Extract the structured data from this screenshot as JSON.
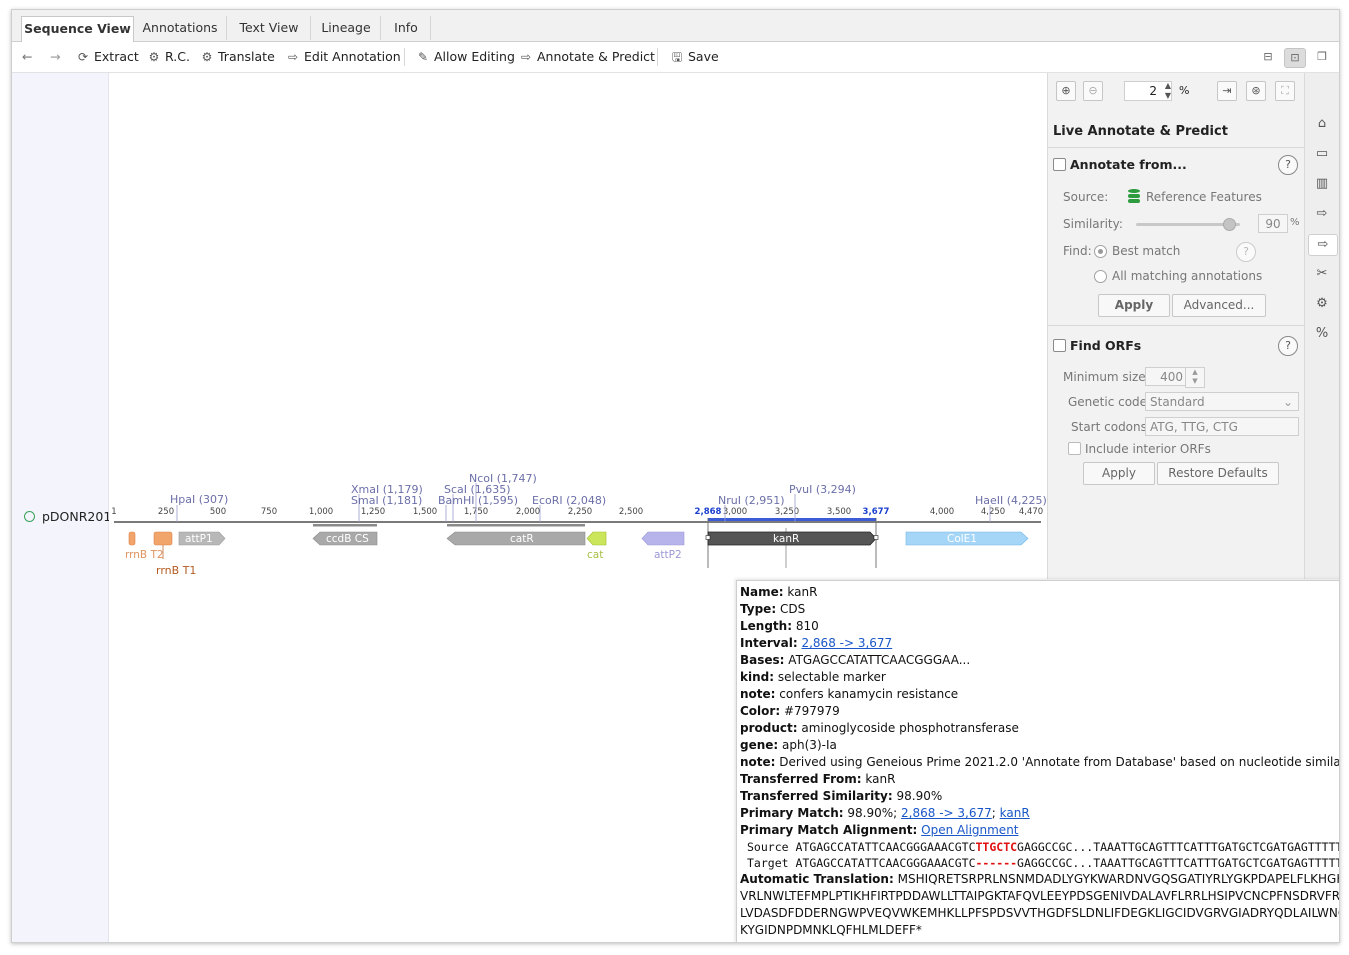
{
  "tabs": [
    "Sequence View",
    "Annotations",
    "Text View",
    "Lineage",
    "Info"
  ],
  "toolbar": {
    "extract": "Extract",
    "rc": "R.C.",
    "translate": "Translate",
    "edit_annotation": "Edit Annotation",
    "allow_editing": "Allow Editing",
    "annotate_predict": "Annotate & Predict",
    "save": "Save"
  },
  "sequence": {
    "name": "pDONR201"
  },
  "map": {
    "ruler_ticks": [
      "1",
      "250",
      "500",
      "750",
      "1,000",
      "1,250",
      "1,500",
      "1,750",
      "2,000",
      "2,250",
      "2,500",
      "3,000",
      "3,250",
      "3,500",
      "4,000",
      "4,250",
      "4,470"
    ],
    "selection_start": "2,868",
    "selection_end": "3,677",
    "enzymes": [
      "HpaI (307)",
      "XmaI (1,179)",
      "SmaI (1,181)",
      "NcoI (1,747)",
      "ScaI (1,635)",
      "BamHI (1,595)",
      "EcoRI (2,048)",
      "NruI (2,951)",
      "PvuI (3,294)",
      "HaeII (4,225)"
    ],
    "features": {
      "rrnB_T2": "rrnB T2",
      "rrnB_T1": "rrnB T1",
      "attP1": "attP1",
      "ccdB": "ccdB CS",
      "catR": "catR",
      "cat": "cat",
      "attP2": "attP2",
      "kanR": "kanR",
      "ColE1": "ColE1"
    }
  },
  "zoom": {
    "value": "2",
    "unit": "%"
  },
  "panel": {
    "title": "Live Annotate & Predict",
    "annotate_from": "Annotate from...",
    "source_label": "Source:",
    "source_value": "Reference Features",
    "similarity_label": "Similarity:",
    "similarity_value": "90",
    "similarity_unit": "%",
    "find_label": "Find:",
    "best_match": "Best match",
    "all_matching": "All matching annotations",
    "apply": "Apply",
    "advanced": "Advanced...",
    "find_orfs": "Find ORFs",
    "min_size_label": "Minimum size:",
    "min_size_value": "400",
    "genetic_code_label": "Genetic code:",
    "genetic_code_value": "Standard",
    "start_codons_label": "Start codons:",
    "start_codons_value": "ATG, TTG, CTG",
    "include_interior": "Include interior ORFs",
    "apply2": "Apply",
    "restore": "Restore Defaults"
  },
  "tooltip": {
    "name_k": "Name:",
    "name_v": "kanR",
    "type_k": "Type:",
    "type_v": "CDS",
    "length_k": "Length:",
    "length_v": "810",
    "interval_k": "Interval:",
    "interval_v": "2,868 -> 3,677",
    "bases_k": "Bases:",
    "bases_v": "ATGAGCCATATTCAACGGGAA...",
    "kind_k": "kind:",
    "kind_v": "selectable marker",
    "note1_k": "note:",
    "note1_v": "confers kanamycin resistance",
    "color_k": "Color:",
    "color_v": "#797979",
    "product_k": "product:",
    "product_v": "aminoglycoside phosphotransferase",
    "gene_k": "gene:",
    "gene_v": "aph(3)-Ia",
    "note2_k": "note:",
    "note2_v": "Derived using Geneious Prime 2021.2.0 'Annotate from Database' based on nucleotide similarity",
    "tfrom_k": "Transferred From:",
    "tfrom_v": "kanR",
    "tsim_k": "Transferred Similarity:",
    "tsim_v": "98.90%",
    "pm_k": "Primary Match:",
    "pm_v": "98.90%;",
    "pm_link1": "2,868 -> 3,677",
    "pm_sep": ";",
    "pm_link2": "kanR",
    "pma_k": "Primary Match Alignment:",
    "pma_link": "Open Alignment",
    "src_label": "Source",
    "src_a": "ATGAGCCATATTCAACGGGAAACGTC",
    "src_red": "TTGCTC",
    "src_b": "GAGGCCGC...TAAATTGCAGTTTCATTTGATGCTCGATGAGTTTTTC",
    "tgt_label": "Target",
    "tgt_a": "ATGAGCCATATTCAACGGGAAACGTC",
    "tgt_red": "------",
    "tgt_b": "GAGGCCGC...TAAATTGCAGTTTCATTTGATGCTCGATGAGTTTTTC",
    "at_k": "Automatic Translation:",
    "at_1": "MSHIQRETSRPRLNSNMDADLYGYKWARDNVGQSGATIYRLYGKPDAPELFLKHGKGSVANDVTDEMVRLNWLTEFMPLPTIKHFIRT",
    "at_2": "VRLNWLTEFMPLPTIKHFIRTPDDAWLLTTAIPGKTAFQVLEEYPDSGENIVDALAVFLRRLHSIPVCNCPFNSDRVFRLAQAQSRMNNGL",
    "at_3": "LVDASDFDDERNGWPVEQVWKEMHKLLPFSPDSVVTHGDFSLDNLIFDEGKLIGCIDVGRVGIADRYQDLAILWNCLGEFSPSLQKRLFQ",
    "at_4": "KYGIDNPDMNKLQFHLMLDEFF*"
  },
  "colors": {
    "kanR": "#797979",
    "selection": "#1a3fd0",
    "enzyme_label": "#6b6fa8",
    "link": "#1a57c8"
  }
}
